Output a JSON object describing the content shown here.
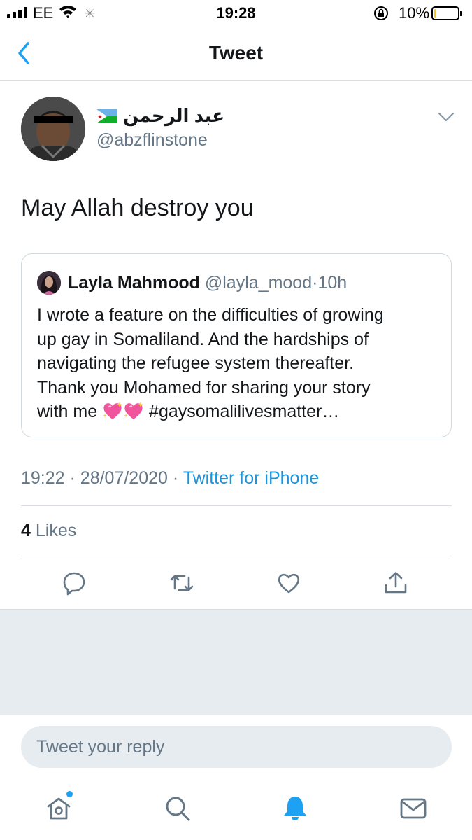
{
  "status_bar": {
    "carrier": "EE",
    "time": "19:28",
    "battery_percent_label": "10%",
    "battery_level": 0.1,
    "battery_color": "#f5c518"
  },
  "nav": {
    "title": "Tweet",
    "back_icon": "chevron-left-icon"
  },
  "tweet": {
    "display_name": "عبد الرحمن",
    "flag_icon": "djibouti-flag-icon",
    "handle": "@abzflinstone",
    "text": "May Allah destroy you",
    "time": "19:22",
    "date": "28/07/2020",
    "separator": "·",
    "source": "Twitter for iPhone",
    "likes_count": "4",
    "likes_label": "Likes"
  },
  "quoted_tweet": {
    "display_name": "Layla Mahmood",
    "handle": "@layla_mood",
    "age": "10h",
    "lines": [
      "I wrote a feature on the difficulties of growing",
      "up gay in Somaliland. And the hardships of",
      "navigating the refugee system thereafter.",
      "Thank you Mohamed for sharing your story"
    ],
    "last_line_prefix": "with me",
    "last_line_suffix": "#gaysomalilivesmatter…",
    "emoji_icon": "sparkling-heart-icon"
  },
  "actions": [
    "reply-icon",
    "retweet-icon",
    "like-icon",
    "share-icon"
  ],
  "reply": {
    "placeholder": "Tweet your reply"
  },
  "tab_bar": [
    "home-icon",
    "search-icon",
    "notifications-icon",
    "messages-icon"
  ],
  "colors": {
    "accent": "#1da1f2",
    "link": "#1b95e0",
    "secondary_text": "#657786",
    "icon_gray": "#657786"
  }
}
